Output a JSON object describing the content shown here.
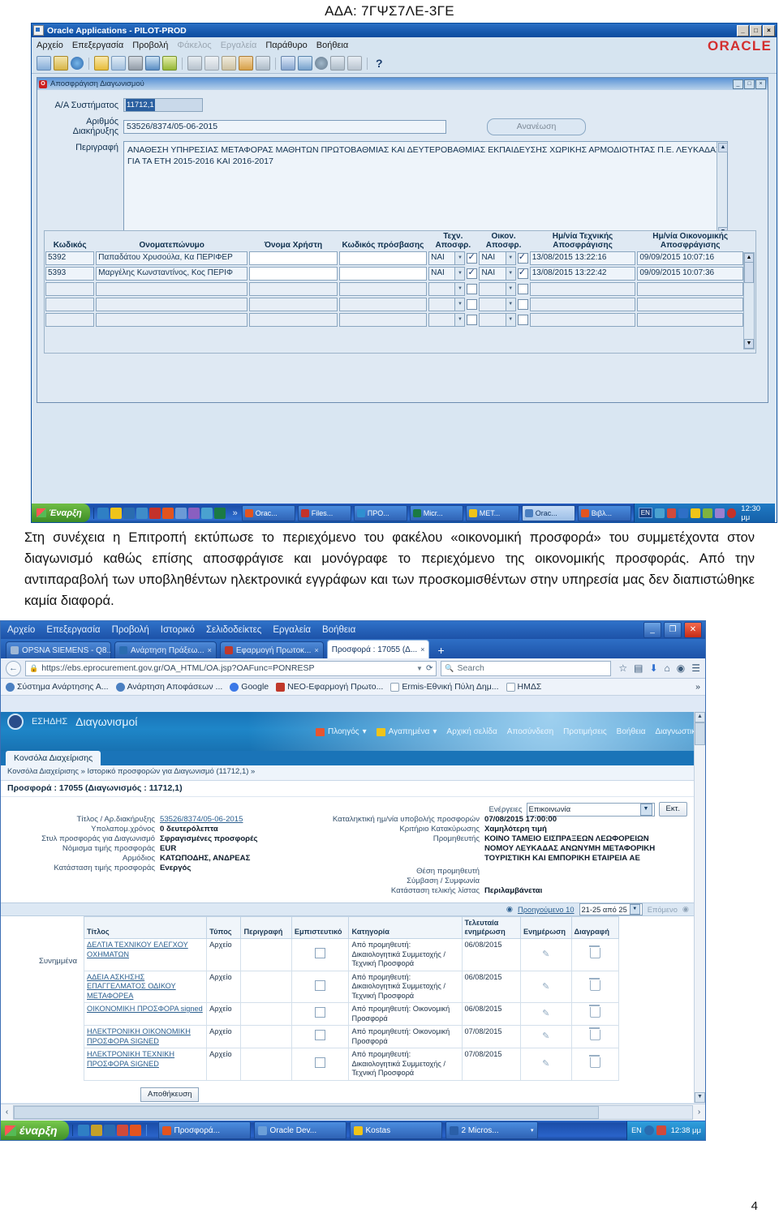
{
  "ada": "ΑΔΑ: 7ΓΨΣ7ΛΕ-3ΓΕ",
  "page_number": "4",
  "oracle": {
    "window_title": "Oracle Applications - PILOT-PROD",
    "brand": "ORACLE",
    "menu": [
      "Αρχείο",
      "Επεξεργασία",
      "Προβολή",
      "Φάκελος",
      "Εργαλεία",
      "Παράθυρο",
      "Βοήθεια"
    ],
    "help_glyph": "?",
    "win_buttons": [
      "_",
      "□",
      "×"
    ],
    "inner": {
      "title": "Αποσφράγιση Διαγωνισμού",
      "win_buttons": [
        "_",
        "□",
        "×"
      ],
      "fields": {
        "aa_label": "Α/Α Συστήματος",
        "aa_value": "11712,1",
        "diak_label": "Αριθμός Διακήρυξης",
        "diak_value": "53526/8374/05-06-2015",
        "desc_label": "Περιγραφή",
        "desc_value": "ΑΝΑΘΕΣΗ ΥΠΗΡΕΣΙΑΣ ΜΕΤΑΦΟΡΑΣ ΜΑΘΗΤΩΝ ΠΡΩΤΟΒΑΘΜΙΑΣ ΚΑΙ ΔΕΥΤΕΡΟΒΑΘΜΙΑΣ ΕΚΠΑΙΔΕΥΣΗΣ ΧΩΡΙΚΗΣ ΑΡΜΟΔΙΟΤΗΤΑΣ Π.Ε. ΛΕΥΚΑΔΑΣ ΓΙΑ ΤΑ ΕΤΗ 2015-2016 ΚΑΙ 2016-2017",
        "refresh_button": "Ανανέωση"
      },
      "grid": {
        "headers": [
          "Κωδικός",
          "Ονοματεπώνυμο",
          "Όνομα Χρήστη",
          "Κωδικός πρόσβασης",
          "Τεχν. Αποσφρ.",
          "Οικον. Αποσφρ.",
          "Ημ/νία Τεχνικής Αποσφράγισης",
          "Ημ/νία Οικονομικής Αποσφράγισης"
        ],
        "rows": [
          {
            "kodikos": "5392",
            "onoma": "Παπαδάτου Χρυσούλα, Κα ΠΕΡΙΦΕΡ",
            "user": "",
            "pass": "",
            "texn": "ΝΑΙ",
            "texn_chk": true,
            "oikon": "ΝΑΙ",
            "oikon_chk": true,
            "d1": "13/08/2015 13:22:16",
            "d2": "09/09/2015 10:07:16"
          },
          {
            "kodikos": "5393",
            "onoma": "Μαργέλης Κωνσταντίνος, Κος ΠΕΡΙΦ",
            "user": "",
            "pass": "",
            "texn": "ΝΑΙ",
            "texn_chk": true,
            "oikon": "ΝΑΙ",
            "oikon_chk": true,
            "d1": "13/08/2015 13:22:42",
            "d2": "09/09/2015 10:07:36"
          },
          {
            "kodikos": "",
            "onoma": "",
            "user": "",
            "pass": "",
            "texn": "",
            "texn_chk": false,
            "oikon": "",
            "oikon_chk": false,
            "d1": "",
            "d2": ""
          },
          {
            "kodikos": "",
            "onoma": "",
            "user": "",
            "pass": "",
            "texn": "",
            "texn_chk": false,
            "oikon": "",
            "oikon_chk": false,
            "d1": "",
            "d2": ""
          },
          {
            "kodikos": "",
            "onoma": "",
            "user": "",
            "pass": "",
            "texn": "",
            "texn_chk": false,
            "oikon": "",
            "oikon_chk": false,
            "d1": "",
            "d2": ""
          }
        ]
      }
    },
    "taskbar": {
      "start": "Έναρξη",
      "chevron": "»",
      "buttons": [
        {
          "label": "Orac...",
          "color": "#e3541f"
        },
        {
          "label": "Files...",
          "color": "#c4322a"
        },
        {
          "label": "ΠΡΟ...",
          "color": "#2f8fd0"
        },
        {
          "label": "Micr...",
          "color": "#1b7a43"
        },
        {
          "label": "ΜΕΤ...",
          "color": "#f0c419"
        },
        {
          "label": "Orac...",
          "color": "#4a7fc1",
          "active": true
        },
        {
          "label": "Βιβλ...",
          "color": "#e3541f"
        }
      ],
      "lang": "EN",
      "clock": "12:30 μμ"
    }
  },
  "paragraph": "Στη συνέχεια η Επιτροπή εκτύπωσε το περιεχόμενο του φακέλου «οικονομική προσφορά» του συμμετέχοντα στον διαγωνισμό καθώς επίσης αποσφράγισε και μονόγραφε το περιεχόμενο της οικονομικής προσφοράς. Από την αντιπαραβολή των υποβληθέντων ηλεκτρονικά εγγράφων και των προσκομισθέντων στην υπηρεσία μας δεν διαπιστώθηκε καμία διαφορά.",
  "browser": {
    "menu": [
      "Αρχείο",
      "Επεξεργασία",
      "Προβολή",
      "Ιστορικό",
      "Σελιδοδείκτες",
      "Εργαλεία",
      "Βοήθεια"
    ],
    "win_buttons": [
      "_",
      "❐",
      "✕"
    ],
    "tabs": [
      {
        "label": "OPSNA SIEMENS - Q8...",
        "close": "×",
        "active": false,
        "fav": "#4a7fc1"
      },
      {
        "label": "Ανάρτηση Πράξεω...",
        "close": "×",
        "active": false,
        "fav": "#2a6cb0"
      },
      {
        "label": "Εφαρμογή Πρωτοκ...",
        "close": "×",
        "active": false,
        "fav": "#c0392b"
      },
      {
        "label": "Προσφορά : 17055 (Δ...",
        "close": "×",
        "active": true,
        "fav": "#ffffff"
      }
    ],
    "new_tab": "+",
    "url": "https://ebs.eprocurement.gov.gr/OA_HTML/OA.jsp?OAFunc=PONRESP",
    "url_bold": "eprocurement.gov.gr",
    "search_placeholder": "Search",
    "nav_icons": [
      "star-icon",
      "reader-icon",
      "download-icon",
      "home-icon",
      "sync-icon",
      "menu-icon"
    ],
    "bookmarks": [
      {
        "label": "Σύστημα Ανάρτησης Α...",
        "icon": "globe"
      },
      {
        "label": "Ανάρτηση Αποφάσεων ...",
        "icon": "globe"
      },
      {
        "label": "Google",
        "icon": "google"
      },
      {
        "label": "ΝΕΟ-Εφαρμογή Πρωτο...",
        "icon": "redA"
      },
      {
        "label": "Ermis-Εθνική Πύλη Δημ...",
        "icon": "square"
      },
      {
        "label": "ΗΜΔΣ",
        "icon": "square"
      }
    ],
    "bookmarks_overflow": "»"
  },
  "app": {
    "brand_small": "ΕΣΗΔΗΣ",
    "brand_title": "Διαγωνισμοί",
    "globalnav": [
      "Πλοηγός",
      "Αγαπημένα",
      "Αρχική σελίδα",
      "Αποσύνδεση",
      "Προτιμήσεις",
      "Βοήθεια",
      "Διαγνωστικά"
    ],
    "tab": "Κονσόλα Διαχείρισης",
    "breadcrumb": "Κονσόλα Διαχείρισης  »   Ιστορικό προσφορών για Διαγωνισμό (11712,1)  »",
    "subtitle": "Προσφορά : 17055 (Διαγωνισμός : 11712,1)",
    "left_details": [
      {
        "label": "Τίτλος / Αρ.διακήρυξης",
        "value": "53526/8374/05-06-2015",
        "link": true
      },
      {
        "label": "Υπολαπομ.χρόνος",
        "value": "0 δευτερόλεπτα",
        "link": false
      },
      {
        "label": "Στυλ προσφοράς για Διαγωνισμό",
        "value": "Σφραγισμένες προσφορές",
        "link": false
      },
      {
        "label": "Νόμισμα τιμής προσφοράς",
        "value": "EUR",
        "link": false
      },
      {
        "label": "Αρμόδιος",
        "value": "ΚΑΤΩΠΟΔΗΣ, ΑΝΔΡΕΑΣ",
        "link": false
      },
      {
        "label": "Κατάσταση τιμής προσφοράς",
        "value": "Ενεργός",
        "link": false
      }
    ],
    "actions_label": "Ενέργειες",
    "actions_value": "Επικοινωνία",
    "actions_go": "Εκτ.",
    "right_details": [
      {
        "label": "Καταληκτική ημ/νία υποβολής προσφορών",
        "value": "07/08/2015 17:00:00"
      },
      {
        "label": "Κριτήριο Κατακύρωσης",
        "value": "Χαμηλότερη τιμή"
      },
      {
        "label": "Προμηθευτής",
        "value": "ΚΟΙΝΟ ΤΑΜΕΙΟ ΕΙΣΠΡΑΞΕΩΝ ΛΕΩΦΟΡΕΙΩΝ ΝΟΜΟΥ ΛΕΥΚΑΔΑΣ ΑΝΩΝΥΜΗ ΜΕΤΑΦΟΡΙΚΗ ΤΟΥΡΙΣΤΙΚΗ ΚΑΙ ΕΜΠΟΡΙΚΗ ΕΤΑΙΡΕΙΑ ΑΕ"
      },
      {
        "label": "Θέση προμηθευτή",
        "value": ""
      },
      {
        "label": "Σύμβαση / Συμφωνία",
        "value": ""
      },
      {
        "label": "Κατάσταση τελικής λίστας",
        "value": "Περιλαμβάνεται"
      }
    ],
    "pager": {
      "prev": "Προηγούμενο 10",
      "range": "21-25 από 25",
      "next": "Επόμενο"
    },
    "attachments_label": "Συνημμένα",
    "att_headers": [
      "Τίτλος",
      "Τύπος",
      "Περιγραφή",
      "Εμπιστευτικό",
      "Κατηγορία",
      "Τελευταία ενημέρωση",
      "Ενημέρωση",
      "Διαγραφή"
    ],
    "att_rows": [
      {
        "title": "ΔΕΛΤΙΑ ΤΕΧΝΙΚΟΥ ΕΛΕΓΧΟΥ ΟΧΗΜΑΤΩΝ",
        "type": "Αρχείο",
        "desc": "",
        "conf": false,
        "cat": "Από προμηθευτή: Δικαιολογητικά Συμμετοχής /Τεχνική Προσφορά",
        "updated": "06/08/2015"
      },
      {
        "title": "ΑΔΕΙΑ ΑΣΚΗΣΗΣ ΕΠΑΓΓΕΛΜΑΤΟΣ ΟΔΙΚΟΥ ΜΕΤΑΦΟΡΕΑ",
        "type": "Αρχείο",
        "desc": "",
        "conf": false,
        "cat": "Από προμηθευτή: Δικαιολογητικά Συμμετοχής /Τεχνική Προσφορά",
        "updated": "06/08/2015"
      },
      {
        "title": "ΟΙΚΟΝΟΜΙΚΗ ΠΡΟΣΦΟΡΑ signed",
        "type": "Αρχείο",
        "desc": "",
        "conf": false,
        "cat": "Από προμηθευτή: Οικονομική Προσφορά",
        "updated": "06/08/2015"
      },
      {
        "title": "ΗΛΕΚΤΡΟΝΙΚΗ ΟΙΚΟΝΟΜΙΚΗ ΠΡΟΣΦΟΡΑ SIGNED",
        "type": "Αρχείο",
        "desc": "",
        "conf": false,
        "cat": "Από προμηθευτή: Οικονομική Προσφορά",
        "updated": "07/08/2015"
      },
      {
        "title": "ΗΛΕΚΤΡΟΝΙΚΗ ΤΕΧΝΙΚΗ ΠΡΟΣΦΟΡΑ SIGNED",
        "type": "Αρχείο",
        "desc": "",
        "conf": false,
        "cat": "Από προμηθευτή: Δικαιολογητικά Συμμετοχής /Τεχνική Προσφορά",
        "updated": "07/08/2015"
      }
    ],
    "save_button": "Αποθήκευση"
  },
  "browser_taskbar": {
    "start": "έναρξη",
    "buttons": [
      {
        "label": "Προσφορά...",
        "color": "#e3541f"
      },
      {
        "label": "Oracle Dev...",
        "color": "#6c9fd8"
      },
      {
        "label": "Kostas",
        "color": "#f0c419"
      },
      {
        "label": "2 Micros...",
        "color": "#2a5fa8",
        "dd": "▾"
      }
    ],
    "lang": "EN",
    "clock": "12:38 μμ"
  }
}
